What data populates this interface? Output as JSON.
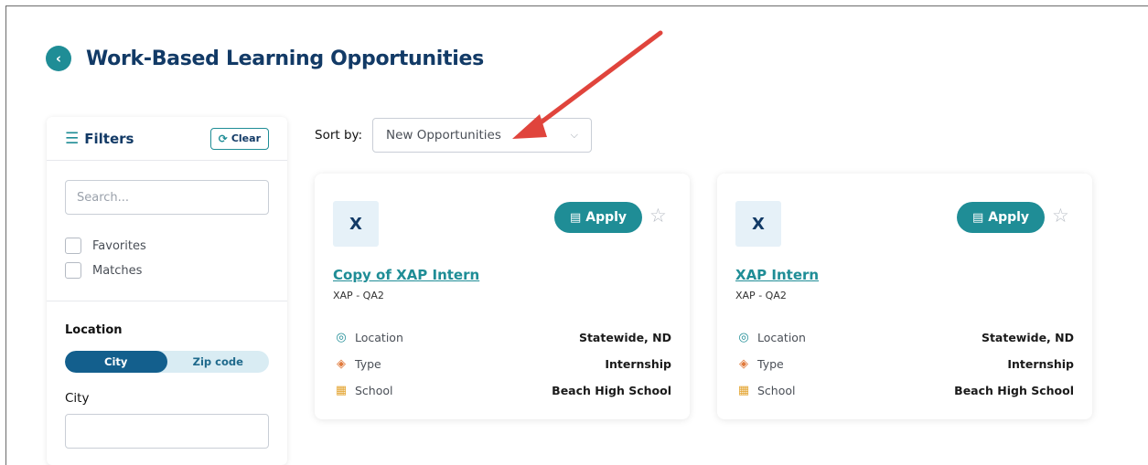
{
  "header": {
    "back_icon": "chevron-left-icon",
    "title": "Work-Based Learning Opportunities"
  },
  "filters": {
    "title": "Filters",
    "title_icon": "sliders-icon",
    "clear_label": "Clear",
    "clear_icon": "refresh-icon",
    "search_placeholder": "Search...",
    "checks": [
      {
        "label": "Favorites",
        "checked": false
      },
      {
        "label": "Matches",
        "checked": false
      }
    ],
    "location_label": "Location",
    "toggle": {
      "city": "City",
      "zip": "Zip code",
      "active": "city"
    },
    "city_label": "City",
    "city_value": ""
  },
  "sort": {
    "label": "Sort by:",
    "selected": "New Opportunities",
    "chevron_icon": "chevron-down-icon"
  },
  "cards": [
    {
      "logo_letter": "X",
      "apply_label": "Apply",
      "title": "Copy of XAP Intern",
      "subtitle": "XAP - QA2",
      "details": [
        {
          "label": "Location",
          "value": "Statewide, ND",
          "icon": "location-pin-icon"
        },
        {
          "label": "Type",
          "value": "Internship",
          "icon": "layers-icon"
        },
        {
          "label": "School",
          "value": "Beach High School",
          "icon": "school-icon"
        }
      ]
    },
    {
      "logo_letter": "X",
      "apply_label": "Apply",
      "title": "XAP Intern",
      "subtitle": "XAP - QA2",
      "details": [
        {
          "label": "Location",
          "value": "Statewide, ND",
          "icon": "location-pin-icon"
        },
        {
          "label": "Type",
          "value": "Internship",
          "icon": "layers-icon"
        },
        {
          "label": "School",
          "value": "Beach High School",
          "icon": "school-icon"
        }
      ]
    }
  ],
  "colors": {
    "accent": "#1f8d96",
    "title": "#123a66",
    "toggle_active": "#135f8d",
    "arrow": "#e0443c"
  }
}
